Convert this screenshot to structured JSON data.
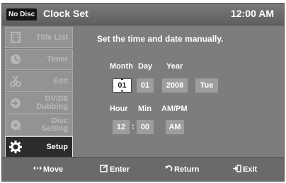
{
  "window": {
    "badge": "No Disc",
    "title": "Clock Set",
    "clock": "12:00 AM"
  },
  "sidebar": {
    "items": [
      {
        "label": "Title List",
        "icon": "film-icon",
        "active": false
      },
      {
        "label": "Timer",
        "icon": "timer-icon",
        "active": false
      },
      {
        "label": "Edit",
        "icon": "scissors-icon",
        "active": false
      },
      {
        "label": "DV/D8\nDubbing",
        "icon": "dubbing-icon",
        "active": false
      },
      {
        "label": "Disc\nSetting",
        "icon": "disc-icon",
        "active": false
      },
      {
        "label": "Setup",
        "icon": "gear-icon",
        "active": true
      }
    ]
  },
  "content": {
    "heading": "Set the time and date manually.",
    "date": {
      "month_label": "Month",
      "day_label": "Day",
      "year_label": "Year",
      "month": "01",
      "day": "01",
      "year": "2008",
      "weekday": "Tue"
    },
    "time": {
      "hour_label": "Hour",
      "min_label": "Min",
      "ampm_label": "AM/PM",
      "hour": "12",
      "separator": ":",
      "minute": "00",
      "ampm": "AM"
    }
  },
  "footer": {
    "move": "Move",
    "enter": "Enter",
    "return": "Return",
    "exit": "Exit"
  }
}
